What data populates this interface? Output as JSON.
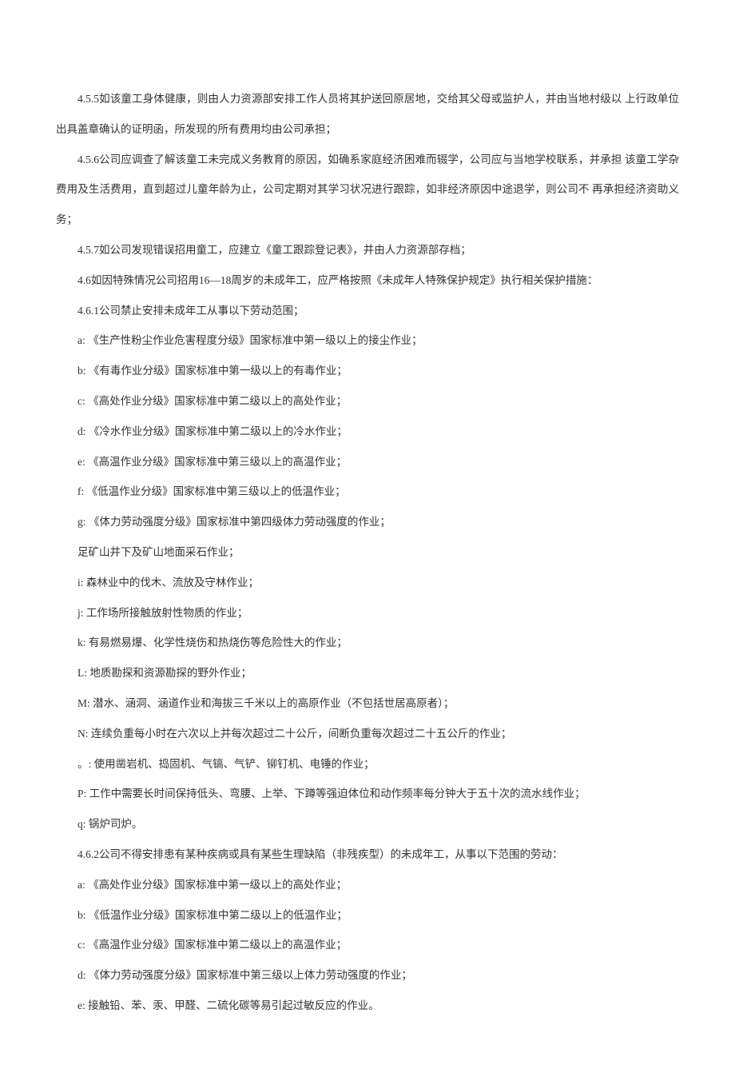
{
  "paragraphs": [
    "4.5.5如该童工身体健康，则由人力资源部安排工作人员将其护送回原居地，交给其父母或监护人，并由当地村级以 上行政单位出具盖章确认的证明函，所发现的所有费用均由公司承担；",
    "4.5.6公司应调查了解该童工未完成义务教育的原因，如确系家庭经济困难而辍学，公司应与当地学校联系，并承担 该童工学杂费用及生活费用，直到超过儿童年龄为止，公司定期对其学习状况进行跟踪，如非经济原因中途退学，则公司不 再承担经济资助义务；",
    "4.5.7如公司发现错误招用童工，应建立《童工跟踪登记表》，并由人力资源部存档；",
    "4.6如因特殊情况公司招用16—18周岁的未成年工，应严格按照《未成年人特殊保护规定》执行相关保护措施：",
    "4.6.1公司禁止安排未成年工从事以下劳动范围；",
    "a: 《生产性粉尘作业危害程度分级》国家标准中第一级以上的接尘作业；",
    "b: 《有毒作业分级》国家标准中第一级以上的有毒作业；",
    "c: 《高处作业分级》国家标准中第二级以上的高处作业；",
    "d: 《冷水作业分级》国家标准中第二级以上的冷水作业；",
    "e: 《高温作业分级》国家标准中第三级以上的高温作业；",
    "f: 《低温作业分级》国家标准中第三级以上的低温作业；",
    "g: 《体力劳动强度分级》国家标准中第四级体力劳动强度的作业；",
    "足矿山井下及矿山地面采石作业；",
    "i: 森林业中的伐木、流放及守林作业；",
    "j: 工作场所接触放射性物质的作业；",
    "k: 有易燃易爆、化学性烧伤和热烧伤等危险性大的作业；",
    "L: 地质勘探和资源勘探的野外作业；",
    "M: 潜水、涵洞、涵道作业和海拔三千米以上的高原作业（不包括世居高原者）；",
    "N: 连续负重每小时在六次以上并每次超过二十公斤，间断负重每次超过二十五公斤的作业；",
    "。: 使用凿岩机、捣固机、气镐、气铲、铆钉机、电锤的作业；",
    "P: 工作中需要长时间保持低头、弯腰、上举、下蹲等强迫体位和动作频率每分钟大于五十次的流水线作业；",
    "q: 锅炉司炉。",
    "4.6.2公司不得安排患有某种疾病或具有某些生理缺陷（非残疾型）的未成年工，从事以下范围的劳动：",
    "a: 《高处作业分级》国家标准中第一级以上的高处作业；",
    "b: 《低温作业分级》国家标准中第二级以上的低温作业；",
    "c: 《高温作业分级》国家标准中第二级以上的高温作业；",
    "d: 《体力劳动强度分级》国家标准中第三级以上体力劳动强度的作业；",
    "e: 接触铅、苯、汞、甲醛、二硫化碳等易引起过敏反应的作业。"
  ]
}
